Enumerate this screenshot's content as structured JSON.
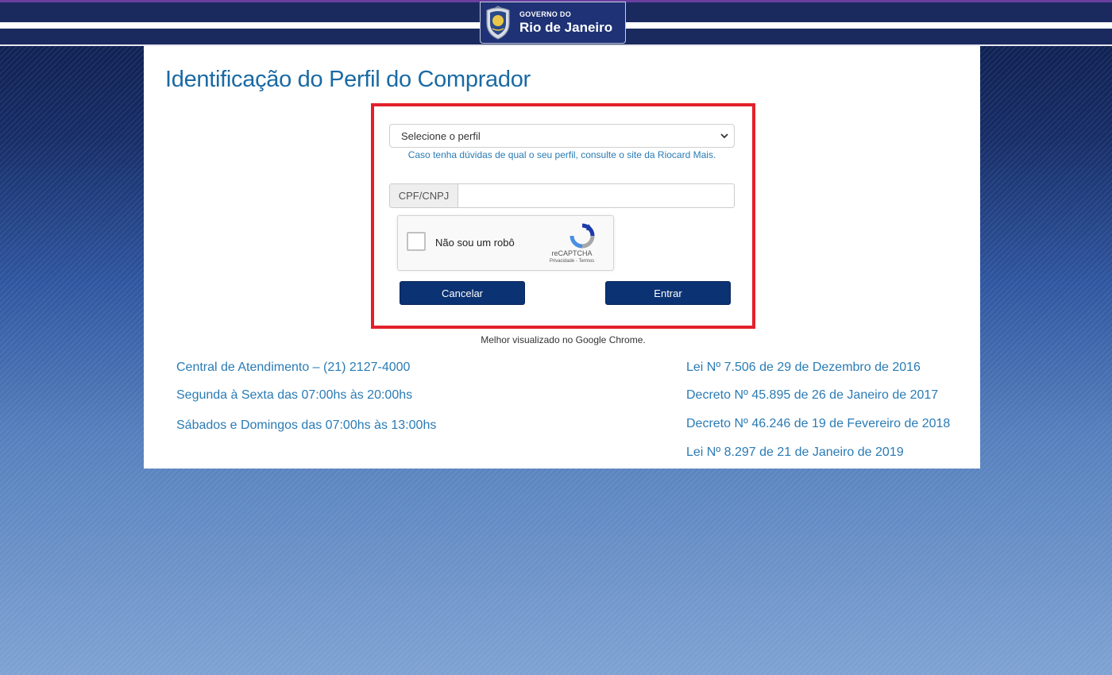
{
  "header": {
    "logo_small": "GOVERNO DO",
    "logo_big": "Rio de Janeiro"
  },
  "page": {
    "title": "Identificação do Perfil do Comprador"
  },
  "form": {
    "profile_select": {
      "value": "Selecione o perfil"
    },
    "help_text": "Caso tenha dúvidas de qual o seu perfil, consulte o site da Riocard Mais.",
    "cpf_label": "CPF/CNPJ",
    "cpf_value": "",
    "captcha": {
      "label": "Não sou um robô",
      "brand": "reCAPTCHA",
      "links": "Privacidade - Termos"
    },
    "cancel_label": "Cancelar",
    "enter_label": "Entrar"
  },
  "best_viewed": "Melhor visualizado no Google Chrome.",
  "contact": {
    "phone": "Central de Atendimento – (21) 2127-4000",
    "weekdays": "Segunda à Sexta das 07:00hs às 20:00hs",
    "weekends": "Sábados e Domingos das 07:00hs às 13:00hs"
  },
  "laws": [
    "Lei Nº 7.506 de 29 de Dezembro de 2016",
    "Decreto Nº 45.895 de 26 de Janeiro de 2017",
    "Decreto Nº 46.246 de 19 de Fevereiro de 2018",
    "Lei Nº 8.297 de 21 de Janeiro de 2019"
  ]
}
